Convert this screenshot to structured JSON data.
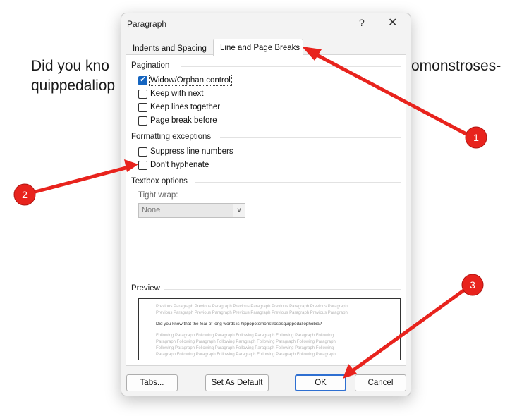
{
  "document": {
    "line1_left": "Did you kno",
    "line1_right": "omonstroses-",
    "line2_left": "quippedaliop"
  },
  "dialog": {
    "title": "Paragraph",
    "help": "?",
    "close": "✕",
    "tabs": [
      {
        "label": "Indents and Spacing",
        "active": false
      },
      {
        "label": "Line and Page Breaks",
        "active": true
      }
    ],
    "pagination": {
      "heading": "Pagination",
      "items": [
        {
          "label": "Widow/Orphan control",
          "checked": true
        },
        {
          "label": "Keep with next",
          "checked": false
        },
        {
          "label": "Keep lines together",
          "checked": false
        },
        {
          "label": "Page break before",
          "checked": false
        }
      ]
    },
    "formatting_exceptions": {
      "heading": "Formatting exceptions",
      "items": [
        {
          "label": "Suppress line numbers",
          "checked": false
        },
        {
          "label": "Don't hyphenate",
          "checked": false
        }
      ]
    },
    "textbox_options": {
      "heading": "Textbox options",
      "tight_wrap_label": "Tight wrap:",
      "tight_wrap_value": "None"
    },
    "preview": {
      "heading": "Preview",
      "previous_lines": [
        "Previous Paragraph Previous Paragraph Previous Paragraph Previous Paragraph Previous Paragraph",
        "Previous Paragraph Previous Paragraph Previous Paragraph Previous Paragraph Previous Paragraph"
      ],
      "main_line": "Did you know that the fear of long words is hippopotomonstrosesquippedaliophobia?",
      "following_lines": [
        "Following Paragraph Following Paragraph Following Paragraph Following Paragraph Following",
        "Paragraph Following Paragraph Following Paragraph Following Paragraph Following Paragraph",
        "Following Paragraph Following Paragraph Following Paragraph Following Paragraph Following",
        "Paragraph Following Paragraph Following Paragraph Following Paragraph Following Paragraph"
      ]
    },
    "buttons": {
      "tabs": "Tabs...",
      "set_default": "Set As Default",
      "ok": "OK",
      "cancel": "Cancel"
    }
  },
  "annotations": {
    "color": "#e8231d",
    "badges": [
      "1",
      "2",
      "3"
    ]
  }
}
